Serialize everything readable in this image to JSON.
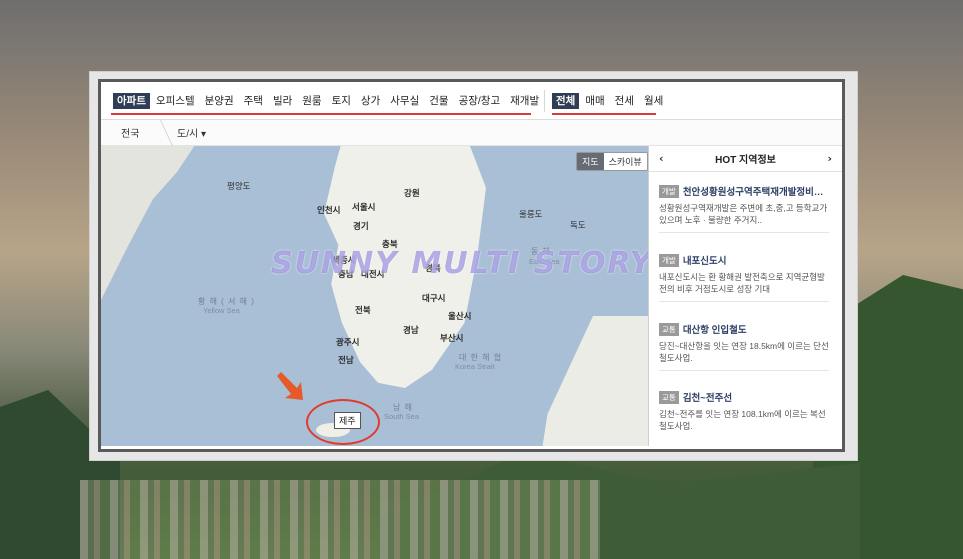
{
  "tabs": {
    "property_types": [
      "아파트",
      "오피스텔",
      "분양권",
      "주택",
      "빌라",
      "원룸",
      "토지",
      "상가",
      "사무실",
      "건물",
      "공장/창고",
      "재개발"
    ],
    "active_property": "아파트",
    "deal_types": [
      "전체",
      "매매",
      "전세",
      "월세"
    ],
    "active_deal": "전체"
  },
  "breadcrumb": {
    "level1": "전국",
    "level2": "도/시 ▾"
  },
  "map": {
    "toggle": {
      "map_label": "지도",
      "sky_label": "스카이뷰",
      "active": "지도"
    },
    "labels": {
      "north_korea_city": "평양도",
      "incheon": "인천시",
      "seoul": "서울시",
      "gyeonggi": "경기",
      "gangwon": "강원",
      "chungbuk": "충북",
      "sejong": "세종시",
      "chungnam": "충남",
      "daejeon": "대전시",
      "gyeongbuk": "경북",
      "daegu": "대구시",
      "jeonbuk": "전북",
      "ulsan": "울산시",
      "gyeongnam": "경남",
      "gwangju": "광주시",
      "busan": "부산시",
      "jeonnam": "전남",
      "jeju": "제주",
      "ulleung": "울릉도",
      "dokdo": "독도",
      "yellow_sea_kr": "황 해 ( 서 해 )",
      "yellow_sea_en": "Yellow Sea",
      "east_sea_kr": "동 해",
      "east_sea_en": "East Sea",
      "korea_strait_kr": "대 한 해 협",
      "korea_strait_en": "Korea Strait",
      "south_sea_kr": "남 해",
      "south_sea_en": "South Sea"
    },
    "watermark": "SUNNY MULTI STORY"
  },
  "hot_info": {
    "header_title": "HOT 지역정보",
    "prev": "‹",
    "next": "›",
    "items": [
      {
        "badge": "개발",
        "title": "천안성황원성구역주택재개발정비…",
        "desc": "성황원성구역재개발은 주변에 초,중,고 등학교가 있으며 노후 · 불량한 주거지.."
      },
      {
        "badge": "개발",
        "title": "내포신도시",
        "desc": "내포신도시는 환 황해권 발전축으로 지역균형발전의 비후 거점도시로 성장 기대"
      },
      {
        "badge": "교통",
        "title": "대산항 인입철도",
        "desc": "당진~대산항을 잇는 연장 18.5km에 이르는 단선 철도사업."
      },
      {
        "badge": "교통",
        "title": "김천~전주선",
        "desc": "김천~전주를 잇는 연장 108.1km에 이르는 복선 철도사업."
      }
    ]
  },
  "colors": {
    "active_tab_bg": "#2f3d55",
    "underline_red": "#d63a3a",
    "sea": "#a9bfd6",
    "land": "#f0f0ea",
    "hot_title": "#2d3e66",
    "highlight": "#e03b2e"
  }
}
